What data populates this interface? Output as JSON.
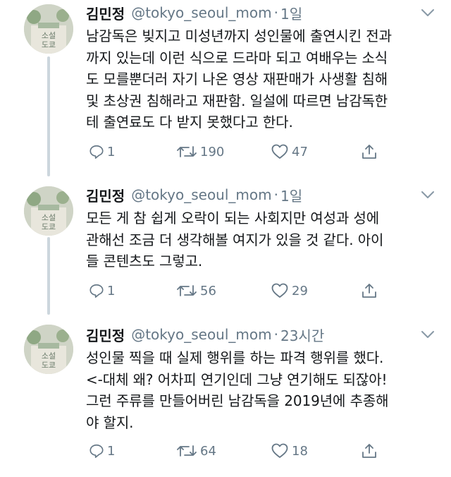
{
  "tweets": [
    {
      "name": "김민정",
      "handle": "@tokyo_seoul_mom",
      "separator": "·",
      "time": "1일",
      "text": "남감독은 빚지고 미성년까지 성인물에 출연시킨 전과\n까지 있는데 이런 식으로 드라마 되고 여배우는 소식\n도 모를뿐더러 자기 나온 영상 재판매가 사생활 침해\n및 초상권 침해라고 재판함. 일설에 따르면 남감독한\n테 출연료도 다 받지 못했다고 한다.",
      "replies": "1",
      "retweets": "190",
      "likes": "47"
    },
    {
      "name": "김민정",
      "handle": "@tokyo_seoul_mom",
      "separator": "·",
      "time": "1일",
      "text": "모든 게 참 쉽게 오락이 되는 사회지만 여성과 성에\n관해선 조금 더 생각해볼 여지가 있을 것 같다. 아이\n들 콘텐츠도 그렇고.",
      "replies": "1",
      "retweets": "56",
      "likes": "29"
    },
    {
      "name": "김민정",
      "handle": "@tokyo_seoul_mom",
      "separator": "·",
      "time": "23시간",
      "text": "성인물 찍을 때 실제 행위를 하는 파격 행위를 했다.\n<-대체 왜? 어차피 연기인데 그냥 연기해도 되잖아!\n그런 주류를 만들어버린 남감독을 2019년에 추종해\n야 할지.",
      "replies": "1",
      "retweets": "64",
      "likes": "18"
    }
  ],
  "avatar": {
    "book_title": "소설 도쿄"
  },
  "icons": {
    "reply": "reply-icon",
    "retweet": "retweet-icon",
    "like": "heart-icon",
    "share": "share-icon",
    "more": "chevron-down-icon"
  },
  "colors": {
    "secondary_text": "#657786",
    "thread_line": "#ccd6dd",
    "text": "#14171a"
  }
}
